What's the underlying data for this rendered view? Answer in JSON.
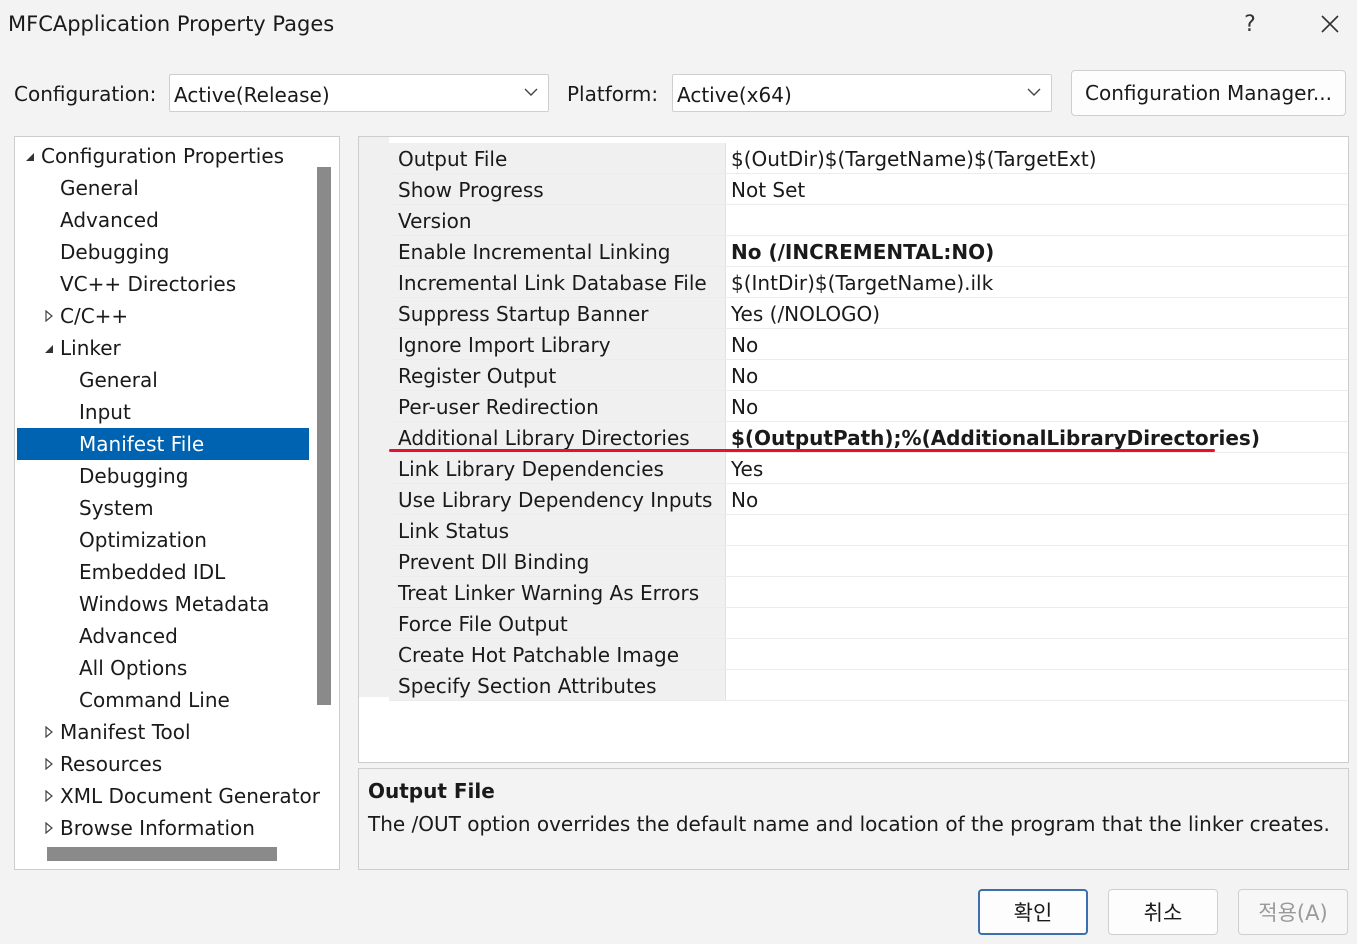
{
  "window": {
    "title": "MFCApplication Property Pages",
    "help_label": "?"
  },
  "toolbar": {
    "configuration_label": "Configuration:",
    "configuration_value": "Active(Release)",
    "platform_label": "Platform:",
    "platform_value": "Active(x64)",
    "config_manager_label": "Configuration Manager..."
  },
  "tree": {
    "selected_index": 9,
    "items": [
      {
        "label": "Configuration Properties",
        "indent": 0,
        "expander": "expanded"
      },
      {
        "label": "General",
        "indent": 1,
        "expander": "none"
      },
      {
        "label": "Advanced",
        "indent": 1,
        "expander": "none"
      },
      {
        "label": "Debugging",
        "indent": 1,
        "expander": "none"
      },
      {
        "label": "VC++ Directories",
        "indent": 1,
        "expander": "none"
      },
      {
        "label": "C/C++",
        "indent": 1,
        "expander": "collapsed"
      },
      {
        "label": "Linker",
        "indent": 1,
        "expander": "expanded"
      },
      {
        "label": "General",
        "indent": 2,
        "expander": "none"
      },
      {
        "label": "Input",
        "indent": 2,
        "expander": "none"
      },
      {
        "label": "Manifest File",
        "indent": 2,
        "expander": "none"
      },
      {
        "label": "Debugging",
        "indent": 2,
        "expander": "none"
      },
      {
        "label": "System",
        "indent": 2,
        "expander": "none"
      },
      {
        "label": "Optimization",
        "indent": 2,
        "expander": "none"
      },
      {
        "label": "Embedded IDL",
        "indent": 2,
        "expander": "none"
      },
      {
        "label": "Windows Metadata",
        "indent": 2,
        "expander": "none"
      },
      {
        "label": "Advanced",
        "indent": 2,
        "expander": "none"
      },
      {
        "label": "All Options",
        "indent": 2,
        "expander": "none"
      },
      {
        "label": "Command Line",
        "indent": 2,
        "expander": "none"
      },
      {
        "label": "Manifest Tool",
        "indent": 1,
        "expander": "collapsed"
      },
      {
        "label": "Resources",
        "indent": 1,
        "expander": "collapsed"
      },
      {
        "label": "XML Document Generator",
        "indent": 1,
        "expander": "collapsed"
      },
      {
        "label": "Browse Information",
        "indent": 1,
        "expander": "collapsed"
      }
    ]
  },
  "properties": [
    {
      "name": "Output File",
      "value": "$(OutDir)$(TargetName)$(TargetExt)",
      "bold": false
    },
    {
      "name": "Show Progress",
      "value": "Not Set",
      "bold": false
    },
    {
      "name": "Version",
      "value": "",
      "bold": false
    },
    {
      "name": "Enable Incremental Linking",
      "value": "No (/INCREMENTAL:NO)",
      "bold": true
    },
    {
      "name": "Incremental Link Database File",
      "value": "$(IntDir)$(TargetName).ilk",
      "bold": false
    },
    {
      "name": "Suppress Startup Banner",
      "value": "Yes (/NOLOGO)",
      "bold": false
    },
    {
      "name": "Ignore Import Library",
      "value": "No",
      "bold": false
    },
    {
      "name": "Register Output",
      "value": "No",
      "bold": false
    },
    {
      "name": "Per-user Redirection",
      "value": "No",
      "bold": false
    },
    {
      "name": "Additional Library Directories",
      "value": "$(OutputPath);%(AdditionalLibraryDirectories)",
      "bold": true,
      "highlighted": true
    },
    {
      "name": "Link Library Dependencies",
      "value": "Yes",
      "bold": false
    },
    {
      "name": "Use Library Dependency Inputs",
      "value": "No",
      "bold": false
    },
    {
      "name": "Link Status",
      "value": "",
      "bold": false
    },
    {
      "name": "Prevent Dll Binding",
      "value": "",
      "bold": false
    },
    {
      "name": "Treat Linker Warning As Errors",
      "value": "",
      "bold": false
    },
    {
      "name": "Force File Output",
      "value": "",
      "bold": false
    },
    {
      "name": "Create Hot Patchable Image",
      "value": "",
      "bold": false
    },
    {
      "name": "Specify Section Attributes",
      "value": "",
      "bold": false
    }
  ],
  "description": {
    "title": "Output File",
    "text": "The /OUT option overrides the default name and location of the program that the linker creates."
  },
  "buttons": {
    "ok": "확인",
    "cancel": "취소",
    "apply": "적용(A)"
  },
  "colors": {
    "selection": "#0063b1",
    "highlight_underline": "#e4122a"
  }
}
